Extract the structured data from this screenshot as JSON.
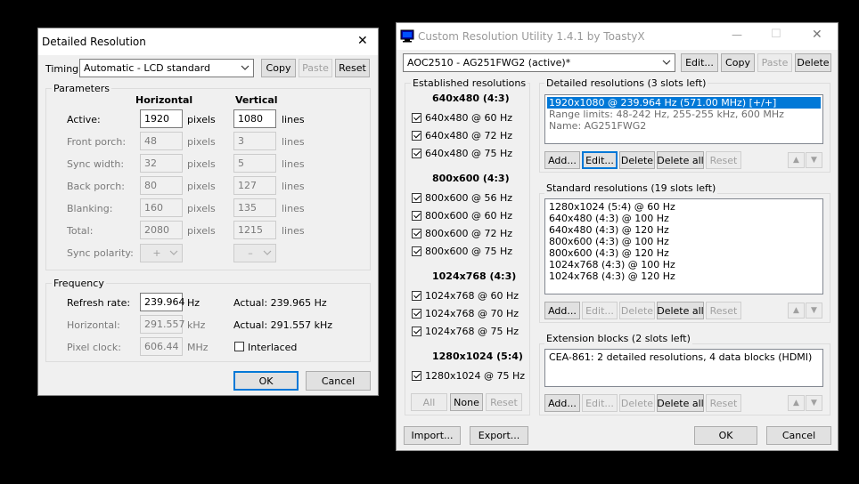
{
  "dialog": {
    "title": "Detailed Resolution",
    "close_glyph": "✕",
    "timing_label": "Timing:",
    "timing_value": "Automatic - LCD standard",
    "copy": "Copy",
    "paste": "Paste",
    "reset": "Reset",
    "params_caption": "Parameters",
    "col_h": "Horizontal",
    "col_v": "Vertical",
    "rows": [
      {
        "label": "Active:",
        "h": "1920",
        "hu": "pixels",
        "v": "1080",
        "vu": "lines"
      },
      {
        "label": "Front porch:",
        "h": "48",
        "hu": "pixels",
        "v": "3",
        "vu": "lines"
      },
      {
        "label": "Sync width:",
        "h": "32",
        "hu": "pixels",
        "v": "5",
        "vu": "lines"
      },
      {
        "label": "Back porch:",
        "h": "80",
        "hu": "pixels",
        "v": "127",
        "vu": "lines"
      },
      {
        "label": "Blanking:",
        "h": "160",
        "hu": "pixels",
        "v": "135",
        "vu": "lines"
      },
      {
        "label": "Total:",
        "h": "2080",
        "hu": "pixels",
        "v": "1215",
        "vu": "lines"
      }
    ],
    "sync_label": "Sync polarity:",
    "sync_h": "+",
    "sync_v": "–",
    "freq_caption": "Frequency",
    "refresh_label": "Refresh rate:",
    "refresh_value": "239.964",
    "refresh_unit": "Hz",
    "refresh_actual": "Actual: 239.965 Hz",
    "horiz_label": "Horizontal:",
    "horiz_value": "291.557",
    "horiz_unit": "kHz",
    "horiz_actual": "Actual: 291.557 kHz",
    "pclk_label": "Pixel clock:",
    "pclk_value": "606.44",
    "pclk_unit": "MHz",
    "interlaced": "Interlaced",
    "ok": "OK",
    "cancel": "Cancel"
  },
  "cru": {
    "title": "Custom Resolution Utility 1.4.1 by ToastyX",
    "min_glyph": "—",
    "max_glyph": "☐",
    "close_glyph": "✕",
    "monitor": "AOC2510 - AG251FWG2 (active)*",
    "edit": "Edit...",
    "copy": "Copy",
    "paste": "Paste",
    "delete": "Delete",
    "established": {
      "caption": "Established resolutions",
      "groups": [
        {
          "title": "640x480 (4:3)",
          "items": [
            "640x480 @ 60 Hz",
            "640x480 @ 72 Hz",
            "640x480 @ 75 Hz"
          ]
        },
        {
          "title": "800x600 (4:3)",
          "items": [
            "800x600 @ 56 Hz",
            "800x600 @ 60 Hz",
            "800x600 @ 72 Hz",
            "800x600 @ 75 Hz"
          ]
        },
        {
          "title": "1024x768 (4:3)",
          "items": [
            "1024x768 @ 60 Hz",
            "1024x768 @ 70 Hz",
            "1024x768 @ 75 Hz"
          ]
        },
        {
          "title": "1280x1024 (5:4)",
          "items": [
            "1280x1024 @ 75 Hz"
          ]
        }
      ],
      "all": "All",
      "none": "None",
      "reset": "Reset"
    },
    "detailed": {
      "caption": "Detailed resolutions (3 slots left)",
      "items": [
        "1920x1080 @ 239.964 Hz (571.00 MHz) [+/+]",
        "Range limits: 48-242 Hz, 255-255 kHz, 600 MHz",
        "Name: AG251FWG2"
      ],
      "add": "Add...",
      "edit": "Edit...",
      "delete": "Delete",
      "delete_all": "Delete all",
      "reset": "Reset"
    },
    "standard": {
      "caption": "Standard resolutions (19 slots left)",
      "items": [
        "1280x1024 (5:4) @ 60 Hz",
        "640x480 (4:3) @ 100 Hz",
        "640x480 (4:3) @ 120 Hz",
        "800x600 (4:3) @ 100 Hz",
        "800x600 (4:3) @ 120 Hz",
        "1024x768 (4:3) @ 100 Hz",
        "1024x768 (4:3) @ 120 Hz"
      ],
      "add": "Add...",
      "edit": "Edit...",
      "delete": "Delete",
      "delete_all": "Delete all",
      "reset": "Reset"
    },
    "extension": {
      "caption": "Extension blocks (2 slots left)",
      "items": [
        "CEA-861: 2 detailed resolutions, 4 data blocks (HDMI)"
      ],
      "add": "Add...",
      "edit": "Edit...",
      "delete": "Delete",
      "delete_all": "Delete all",
      "reset": "Reset"
    },
    "up_glyph": "▲",
    "down_glyph": "▼",
    "import": "Import...",
    "export": "Export...",
    "ok": "OK",
    "cancel": "Cancel"
  },
  "colors": {
    "selection": "#0078d7",
    "accent_border": "#0078d7"
  }
}
